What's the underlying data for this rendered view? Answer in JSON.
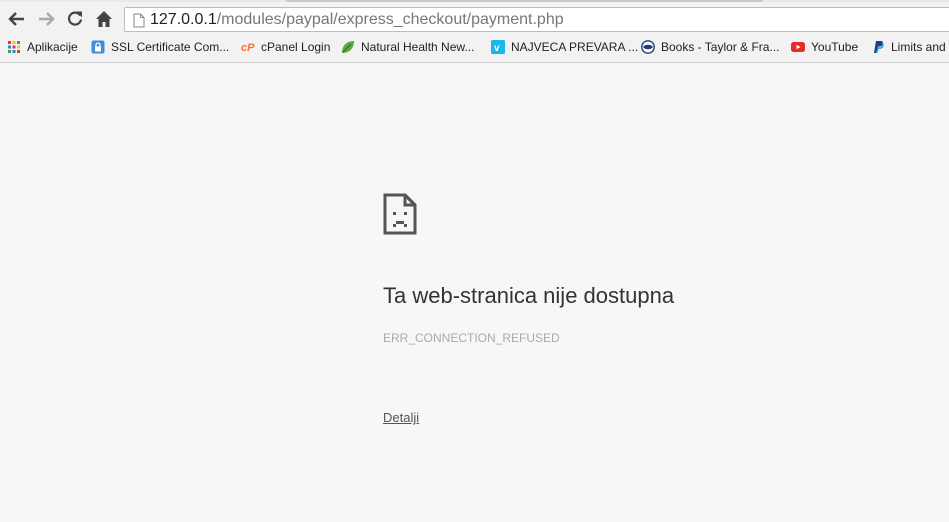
{
  "toolbar": {
    "back_icon": "arrow-left-icon",
    "forward_icon": "arrow-right-icon",
    "reload_icon": "reload-icon",
    "home_icon": "home-icon"
  },
  "omnibox": {
    "host": "127.0.0.1",
    "path": "/modules/paypal/express_checkout/payment.php"
  },
  "bookmarks": [
    {
      "label": "Aplikacije",
      "icon": "apps-grid-icon"
    },
    {
      "label": "SSL Certificate Com...",
      "icon": "lock-icon"
    },
    {
      "label": "cPanel Login",
      "icon": "cpanel-icon"
    },
    {
      "label": "Natural Health New...",
      "icon": "leaf-icon"
    },
    {
      "label": "NAJVECA PREVARA ...",
      "icon": "vimeo-icon"
    },
    {
      "label": "Books - Taylor & Fra...",
      "icon": "globe-icon"
    },
    {
      "label": "YouTube",
      "icon": "youtube-icon"
    },
    {
      "label": "Limits and",
      "icon": "paypal-icon"
    }
  ],
  "error": {
    "title": "Ta web-stranica nije dostupna",
    "code": "ERR_CONNECTION_REFUSED",
    "details_link": "Detalji"
  },
  "colors": {
    "page_background": "#f7f7f7",
    "youtube_red": "#e52d27",
    "vimeo_blue": "#1ab7ea",
    "cpanel_orange": "#ff6c2c",
    "leaf_green": "#5fa83d",
    "paypal_blue": "#253b80"
  }
}
